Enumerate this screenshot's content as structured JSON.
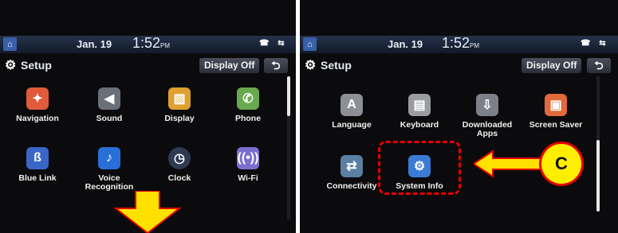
{
  "left_screen": {
    "status": {
      "date": "Jan. 19",
      "time": "1:52",
      "ampm": "PM"
    },
    "header": {
      "title": "Setup",
      "display_off": "Display Off",
      "back_symbol": "⮌"
    },
    "tiles": [
      {
        "label": "Navigation",
        "icon": "compass-icon",
        "color": "#e05a3c"
      },
      {
        "label": "Sound",
        "icon": "speaker-icon",
        "color": "#6b6f78"
      },
      {
        "label": "Display",
        "icon": "picture-icon",
        "color": "#e0a030"
      },
      {
        "label": "Phone",
        "icon": "phone-icon",
        "color": "#6aa84f"
      },
      {
        "label": "Blue Link",
        "icon": "bluelink-icon",
        "color": "#3a66c8"
      },
      {
        "label": "Voice Recognition",
        "icon": "microphone-icon",
        "color": "#2a6fd8"
      },
      {
        "label": "Clock",
        "icon": "clock-icon",
        "color": "#2f3b52"
      },
      {
        "label": "Wi-Fi",
        "icon": "wifi-icon",
        "color": "#7a6fd0"
      }
    ],
    "scroll_position": 0.0
  },
  "right_screen": {
    "status": {
      "date": "Jan. 19",
      "time": "1:52",
      "ampm": "PM"
    },
    "header": {
      "title": "Setup",
      "display_off": "Display Off",
      "back_symbol": "⮌"
    },
    "tiles": [
      {
        "label": "Language",
        "icon": "language-icon",
        "color": "#8c8f96"
      },
      {
        "label": "Keyboard",
        "icon": "keyboard-icon",
        "color": "#9a9ca2"
      },
      {
        "label": "Downloaded Apps",
        "icon": "download-icon",
        "color": "#7d8088"
      },
      {
        "label": "Screen Saver",
        "icon": "screensaver-icon",
        "color": "#e06a3a"
      },
      {
        "label": "Connectivity",
        "icon": "connectivity-icon",
        "color": "#5a7fa0"
      },
      {
        "label": "System Info",
        "icon": "gear-info-icon",
        "color": "#3a7bd5"
      }
    ],
    "scroll_position": 1.0
  },
  "annotations": {
    "callout_label": "C",
    "highlight_color": "#e60000",
    "arrow_color": "#ffe100"
  }
}
